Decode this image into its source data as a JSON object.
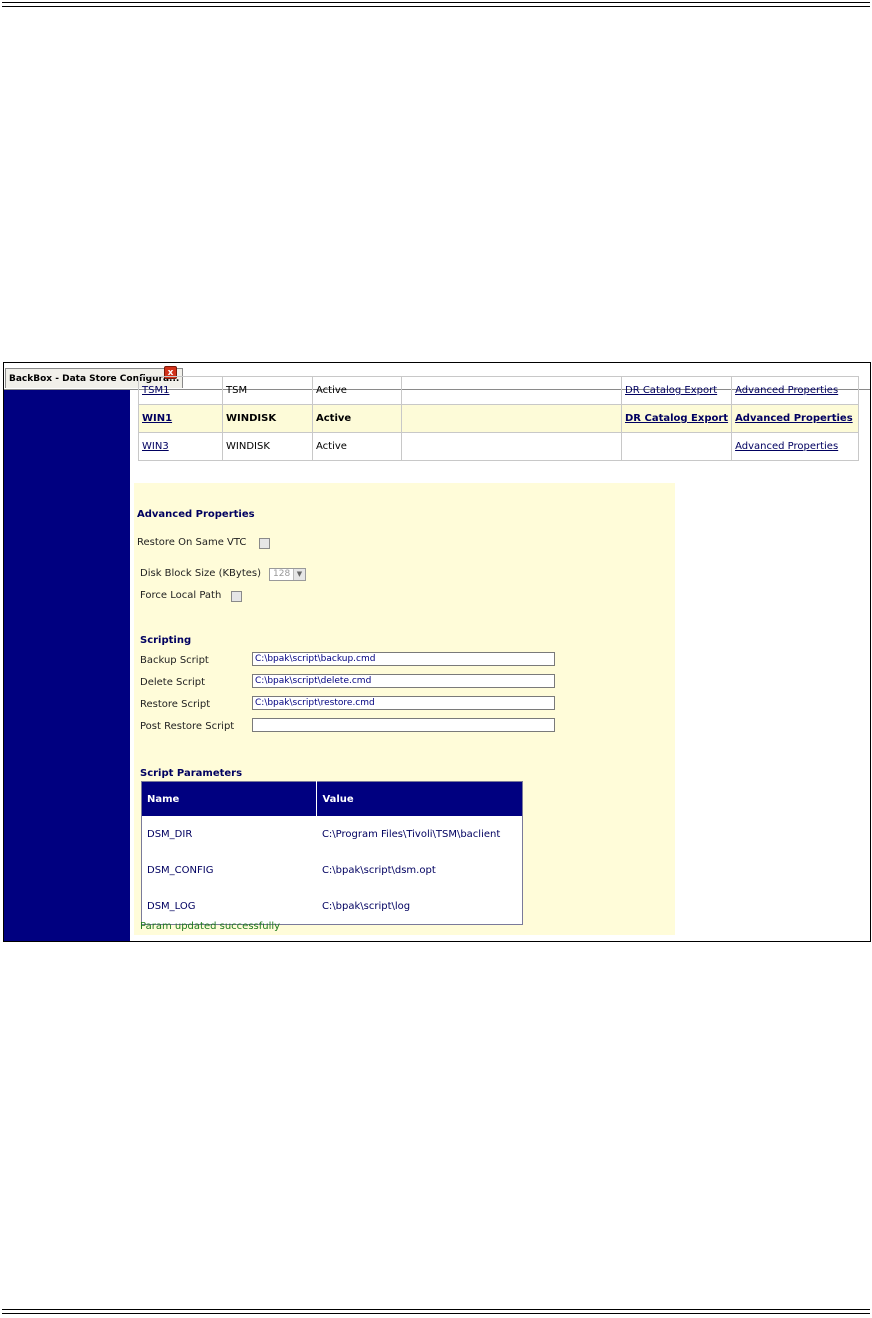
{
  "window": {
    "tab_title": "BackBox - Data Store Configura...",
    "close_glyph": "x"
  },
  "datastores": [
    {
      "name": "TSM1",
      "type": "TSM",
      "status": "Active",
      "extra": "",
      "export": "DR Catalog Export",
      "properties": "Advanced Properties",
      "selected": false
    },
    {
      "name": "WIN1",
      "type": "WINDISK",
      "status": "Active",
      "extra": "",
      "export": "DR Catalog Export",
      "properties": "Advanced Properties",
      "selected": true
    },
    {
      "name": "WIN3",
      "type": "WINDISK",
      "status": "Active",
      "extra": "",
      "export": "",
      "properties": "Advanced Properties",
      "selected": false
    }
  ],
  "advanced": {
    "title": "Advanced Properties",
    "restore_same_vtc_label": "Restore On Same VTC",
    "restore_same_vtc_checked": false,
    "block_size_label": "Disk Block Size (KBytes)",
    "block_size_value": "128",
    "force_local_path_label": "Force Local Path",
    "force_local_path_checked": false
  },
  "scripting": {
    "title": "Scripting",
    "backup_label": "Backup Script",
    "backup_value": "C:\\bpak\\script\\backup.cmd",
    "delete_label": "Delete Script",
    "delete_value": "C:\\bpak\\script\\delete.cmd",
    "restore_label": "Restore Script",
    "restore_value": "C:\\bpak\\script\\restore.cmd",
    "post_restore_label": "Post Restore Script",
    "post_restore_value": ""
  },
  "params": {
    "title": "Script Parameters",
    "col_name": "Name",
    "col_value": "Value",
    "rows": [
      {
        "name": "DSM_DIR",
        "value": "C:\\Program Files\\Tivoli\\TSM\\baclient"
      },
      {
        "name": "DSM_CONFIG",
        "value": "C:\\bpak\\script\\dsm.opt"
      },
      {
        "name": "DSM_LOG",
        "value": "C:\\bpak\\script\\log"
      }
    ]
  },
  "status_message": "Param updated successfully",
  "colors": {
    "sidebar": "#000080",
    "panel": "#fffcd9",
    "header": "#000080",
    "success": "#1e7a1e",
    "close": "#d2321a"
  }
}
